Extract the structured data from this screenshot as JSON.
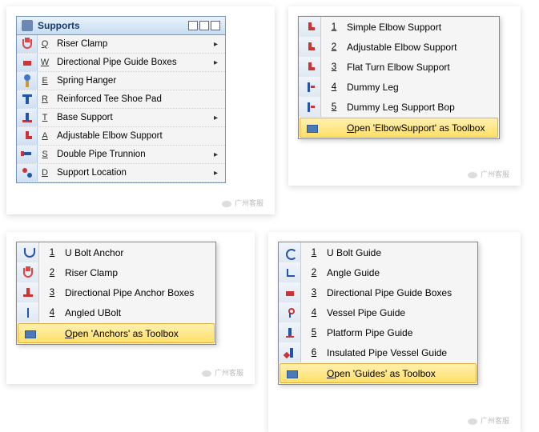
{
  "supports": {
    "title": "Supports",
    "items": [
      {
        "key": "Q",
        "label": "Riser Clamp",
        "icon": "clamp",
        "hasSub": true
      },
      {
        "key": "W",
        "label": "Directional Pipe Guide Boxes",
        "icon": "box",
        "hasSub": true
      },
      {
        "key": "E",
        "label": "Spring Hanger",
        "icon": "spring",
        "hasSub": false
      },
      {
        "key": "R",
        "label": "Reinforced Tee Shoe Pad",
        "icon": "tee",
        "hasSub": false
      },
      {
        "key": "T",
        "label": "Base Support",
        "icon": "base",
        "hasSub": true
      },
      {
        "key": "A",
        "label": "Adjustable Elbow Support",
        "icon": "elbow",
        "hasSub": false
      },
      {
        "key": "S",
        "label": "Double Pipe Trunnion",
        "icon": "trunn",
        "hasSub": true
      },
      {
        "key": "D",
        "label": "Support Location",
        "icon": "pin",
        "hasSub": true
      }
    ]
  },
  "elbow": {
    "items": [
      {
        "num": "1",
        "label": "Simple Elbow Support",
        "icon": "elbow"
      },
      {
        "num": "2",
        "label": "Adjustable Elbow Support",
        "icon": "elbow"
      },
      {
        "num": "3",
        "label": "Flat Turn Elbow Support",
        "icon": "elbow"
      },
      {
        "num": "4",
        "label": "Dummy Leg",
        "icon": "dummy"
      },
      {
        "num": "5",
        "label": "Dummy Leg Support Bop",
        "icon": "dummy"
      }
    ],
    "toolbox_prefix": "O",
    "toolbox_rest": "pen 'ElbowSupport' as Toolbox"
  },
  "anchors": {
    "items": [
      {
        "num": "1",
        "label": "U Bolt Anchor",
        "icon": "ubolt"
      },
      {
        "num": "2",
        "label": "Riser Clamp",
        "icon": "clamp"
      },
      {
        "num": "3",
        "label": "Directional Pipe Anchor Boxes",
        "icon": "anchor"
      },
      {
        "num": "4",
        "label": "Angled UBolt",
        "icon": "angled"
      }
    ],
    "toolbox_prefix": "O",
    "toolbox_rest": "pen 'Anchors' as Toolbox"
  },
  "guides": {
    "items": [
      {
        "num": "1",
        "label": "U Bolt Guide",
        "icon": "guide"
      },
      {
        "num": "2",
        "label": "Angle Guide",
        "icon": "angle"
      },
      {
        "num": "3",
        "label": "Directional Pipe Guide Boxes",
        "icon": "box"
      },
      {
        "num": "4",
        "label": "Vessel Pipe Guide",
        "icon": "vessel"
      },
      {
        "num": "5",
        "label": "Platform Pipe Guide",
        "icon": "platform"
      },
      {
        "num": "6",
        "label": "Insulated Pipe Vessel Guide",
        "icon": "insul"
      }
    ],
    "toolbox_prefix": "O",
    "toolbox_rest": "pen 'Guides' as Toolbox"
  },
  "watermark": "广州客服"
}
